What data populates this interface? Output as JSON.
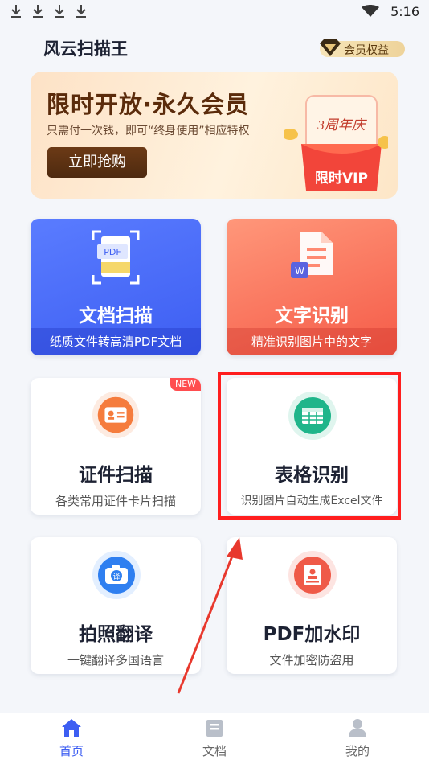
{
  "status": {
    "time": "5:16"
  },
  "header": {
    "title": "风云扫描王",
    "vip_label": "会员权益"
  },
  "banner": {
    "title": "限时开放·永久会员",
    "subtitle": "只需付一次钱，即可“终身使用”相应特权",
    "button": "立即抢购",
    "gift_line1": "3周年庆",
    "gift_line2": "限时VIP"
  },
  "cards": [
    {
      "title": "文档扫描",
      "subtitle": "纸质文件转高清PDF文档",
      "icon": "pdf-scan-icon",
      "badge": "PDF"
    },
    {
      "title": "文字识别",
      "subtitle": "精准识别图片中的文字",
      "icon": "word-doc-icon",
      "badge": "W"
    },
    {
      "title": "证件扫描",
      "subtitle": "各类常用证件卡片扫描",
      "icon": "id-card-icon",
      "new": "NEW"
    },
    {
      "title": "表格识别",
      "subtitle": "识别图片自动生成Excel文件",
      "icon": "table-icon"
    },
    {
      "title": "拍照翻译",
      "subtitle": "一键翻译多国语言",
      "icon": "camera-translate-icon",
      "badge": "译"
    },
    {
      "title": "PDF加水印",
      "subtitle": "文件加密防盗用",
      "icon": "watermark-icon"
    }
  ],
  "nav": [
    {
      "label": "首页",
      "icon": "home-icon",
      "active": true
    },
    {
      "label": "文档",
      "icon": "document-icon",
      "active": false
    },
    {
      "label": "我的",
      "icon": "profile-icon",
      "active": false
    }
  ],
  "colors": {
    "accent": "#3d5ef2",
    "highlight": "#ff1e1e"
  }
}
